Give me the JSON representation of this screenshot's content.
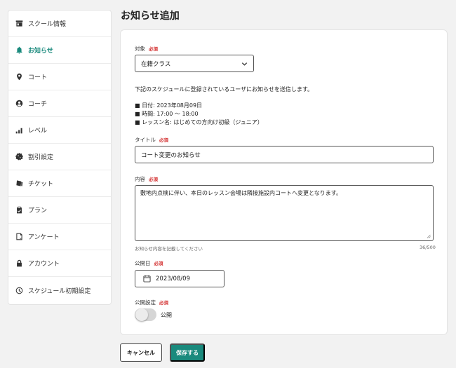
{
  "sidebar": {
    "items": [
      {
        "label": "スクール情報",
        "icon": "store-icon",
        "active": false
      },
      {
        "label": "お知らせ",
        "icon": "bell-icon",
        "active": true
      },
      {
        "label": "コート",
        "icon": "location-pin-icon",
        "active": false
      },
      {
        "label": "コーチ",
        "icon": "user-circle-icon",
        "active": false
      },
      {
        "label": "レベル",
        "icon": "bar-chart-icon",
        "active": false
      },
      {
        "label": "割引設定",
        "icon": "discount-icon",
        "active": false
      },
      {
        "label": "チケット",
        "icon": "ticket-icon",
        "active": false
      },
      {
        "label": "プラン",
        "icon": "clipboard-check-icon",
        "active": false
      },
      {
        "label": "アンケート",
        "icon": "survey-icon",
        "active": false
      },
      {
        "label": "アカウント",
        "icon": "lock-icon",
        "active": false
      },
      {
        "label": "スケジュール初期設定",
        "icon": "schedule-settings-icon",
        "active": false
      }
    ]
  },
  "page": {
    "title": "お知らせ追加"
  },
  "form": {
    "required_label": "必須",
    "target": {
      "label": "対象",
      "value": "在籍クラス"
    },
    "info": {
      "description": "下記のスケジュールに登録されているユーザにお知らせを送信します。",
      "date": "■ 日付: 2023年08月09日",
      "time": "■ 時間: 17:00 〜 18:00",
      "lesson": "■ レッスン名: はじめての方向け初級（ジュニア）"
    },
    "title_field": {
      "label": "タイトル",
      "value": "コート変更のお知らせ"
    },
    "content": {
      "label": "内容",
      "value": "敷地内点検に伴い、本日のレッスン会場は隣接施設内コートへ変更となります。",
      "helper": "お知らせ内容を記載してください",
      "counter": "36/500"
    },
    "publish_date": {
      "label": "公開日",
      "value": "2023/08/09"
    },
    "publish_setting": {
      "label": "公開設定",
      "toggle_label": "公開",
      "enabled": false
    }
  },
  "actions": {
    "cancel": "キャンセル",
    "save": "保存する"
  },
  "colors": {
    "accent": "#1a8a7d",
    "required": "#d32f2f"
  }
}
